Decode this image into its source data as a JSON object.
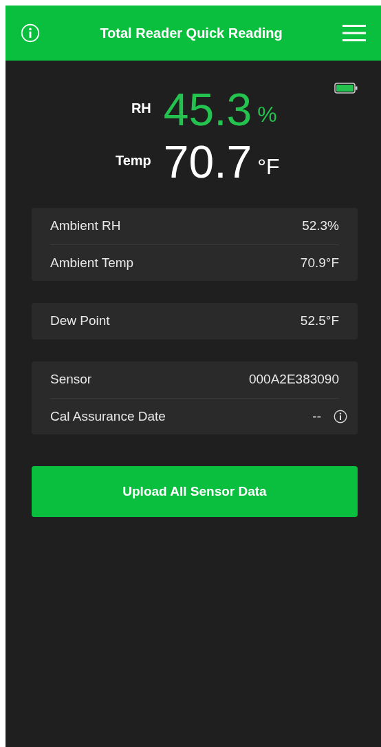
{
  "header": {
    "title": "Total Reader Quick Reading"
  },
  "readings": [
    {
      "label": "RH",
      "value": "45.3",
      "unit": "%",
      "kind": "highlight"
    },
    {
      "label": "Temp",
      "value": "70.7",
      "unit": "°F",
      "kind": "plain"
    }
  ],
  "groups": [
    [
      {
        "label": "Ambient RH",
        "value": "52.3%",
        "kind": "plain"
      },
      {
        "label": "Ambient Temp",
        "value": "70.9°F",
        "kind": "plain"
      }
    ],
    [
      {
        "label": "Dew Point",
        "value": "52.5°F",
        "kind": "plain"
      }
    ],
    [
      {
        "label": "Sensor",
        "value": "000A2E383090",
        "kind": "plain"
      },
      {
        "label": "Cal Assurance Date",
        "value": "--",
        "kind": "info"
      }
    ]
  ],
  "upload_button": "Upload All Sensor Data"
}
